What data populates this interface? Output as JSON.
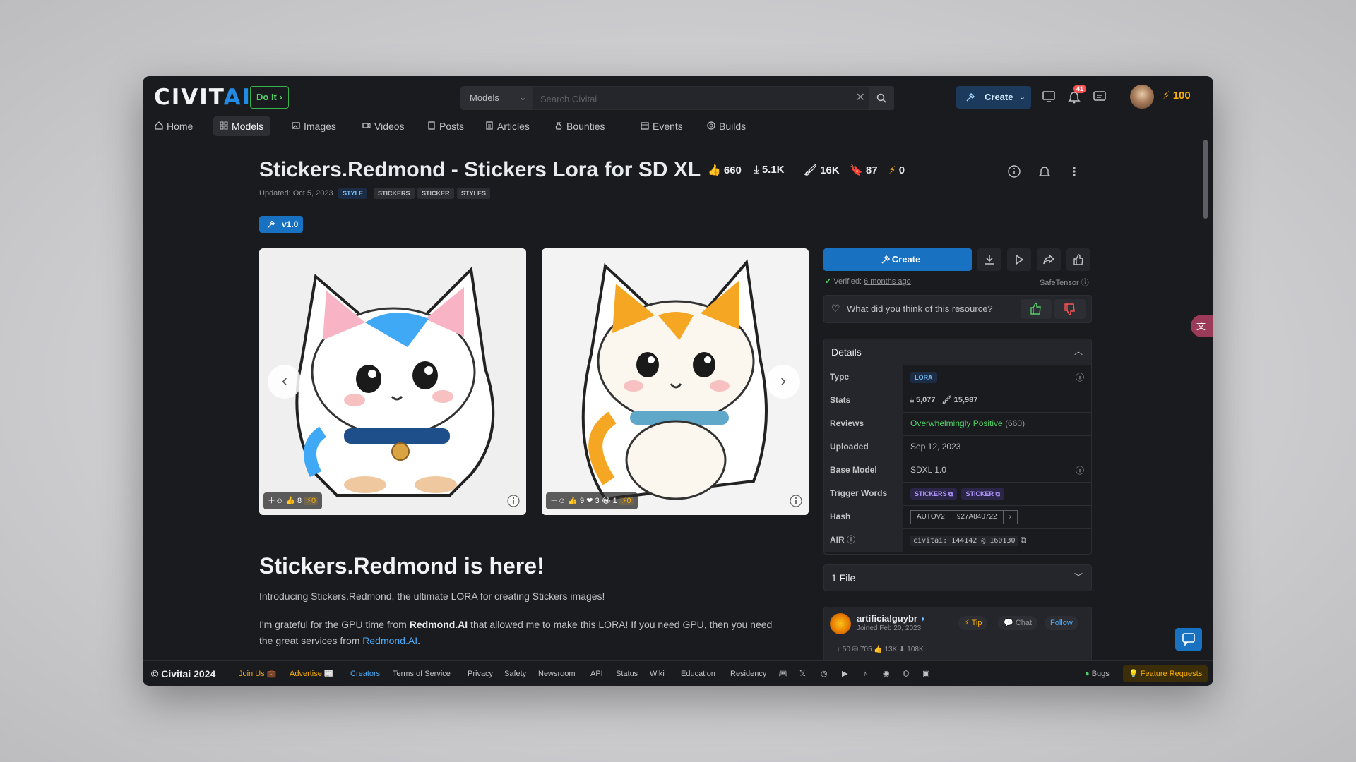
{
  "brand": {
    "logo_a": "CIVIT",
    "logo_b": "AI",
    "doit": "Do It ›"
  },
  "search": {
    "scope": "Models",
    "placeholder": "Search Civitai"
  },
  "header": {
    "create": "Create",
    "notifications": "41",
    "buzz": "100"
  },
  "nav": [
    {
      "label": "Home",
      "icon": "home-icon"
    },
    {
      "label": "Models",
      "icon": "grid-icon",
      "active": true
    },
    {
      "label": "Images",
      "icon": "image-icon"
    },
    {
      "label": "Videos",
      "icon": "video-icon"
    },
    {
      "label": "Posts",
      "icon": "posts-icon"
    },
    {
      "label": "Articles",
      "icon": "article-icon"
    },
    {
      "label": "Bounties",
      "icon": "moneybag-icon"
    },
    {
      "label": "Events",
      "icon": "calendar-icon"
    },
    {
      "label": "Builds",
      "icon": "builds-icon"
    }
  ],
  "model": {
    "title": "Stickers.Redmond - Stickers Lora for SD XL",
    "likes": "660",
    "downloads": "5.1K",
    "generations": "16K",
    "bookmarks": "87",
    "buzz": "0",
    "updated": "Updated: Oct 5, 2023",
    "tags": [
      "STYLE",
      "STICKERS",
      "STICKER",
      "STYLES"
    ],
    "version": "v1.0"
  },
  "gallery": [
    {
      "reactions": {
        "likes": "8",
        "buzz": "0"
      }
    },
    {
      "reactions": {
        "likes": "9",
        "hearts": "3",
        "laugh": "1",
        "buzz": "0"
      }
    }
  ],
  "description": {
    "heading": "Stickers.Redmond is here!",
    "intro": "Introducing Stickers.Redmond, the ultimate LORA for creating Stickers images!",
    "p2_a": "I'm grateful for the GPU time from ",
    "p2_b": "Redmond.AI",
    "p2_c": " that allowed me to make this LORA! If you need GPU, then you need",
    "p2_d": "the great services from ",
    "p2_link": "Redmond.AI",
    "p2_e": "."
  },
  "panel": {
    "create": "Create",
    "verified_label": "Verified:",
    "verified_when": "6 months ago",
    "format": "SafeTensor",
    "feedback_q": "What did you think of this resource?",
    "details_title": "Details",
    "rows": {
      "type_k": "Type",
      "type_v": "LORA",
      "stats_k": "Stats",
      "stats_dl": "5,077",
      "stats_gen": "15,987",
      "reviews_k": "Reviews",
      "reviews_v": "Overwhelmingly Positive",
      "reviews_n": "(660)",
      "uploaded_k": "Uploaded",
      "uploaded_v": "Sep 12, 2023",
      "base_k": "Base Model",
      "base_v": "SDXL 1.0",
      "trigger_k": "Trigger Words",
      "trigger_1": "STICKERS",
      "trigger_2": "STICKER",
      "hash_k": "Hash",
      "hash_type": "AUTOV2",
      "hash_v": "927A840722",
      "air_k": "AIR",
      "air_v": "civitai: 144142 @ 160130"
    },
    "files": "1 File",
    "creator": {
      "name": "artificialguybr",
      "joined": "Joined Feb 20, 2023",
      "tip": "Tip",
      "chat": "Chat",
      "follow": "Follow",
      "stats": "↑ 50   ⛁ 705   👍 13K   ⬇ 108K"
    }
  },
  "footer": {
    "copy": "© Civitai 2024",
    "links": [
      "Join Us 💼",
      "Advertise 📰",
      "Creators",
      "Terms of Service",
      "Privacy",
      "Safety",
      "Newsroom",
      "API",
      "Status",
      "Wiki",
      "Education",
      "Residency"
    ],
    "bugs": "Bugs",
    "feature": "💡 Feature Requests"
  },
  "colors": {
    "accent": "#1971c2",
    "positive": "#51cf66",
    "buzz": "#fab005",
    "bg": "#1a1b1e"
  }
}
